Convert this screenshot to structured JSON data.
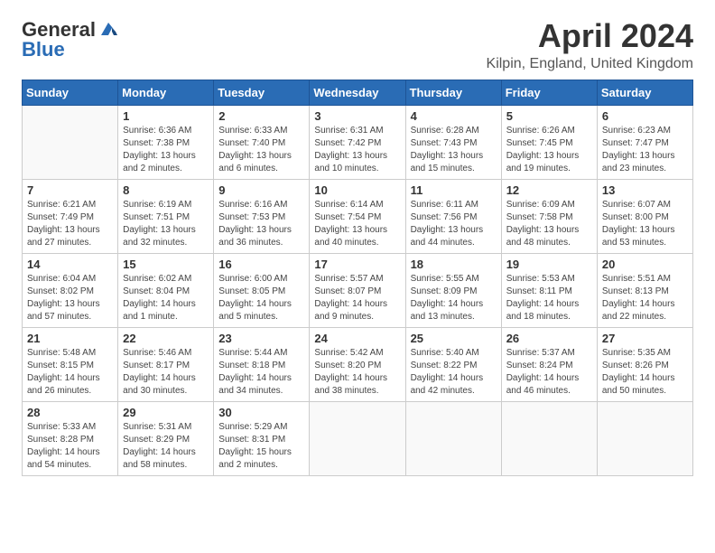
{
  "header": {
    "logo_general": "General",
    "logo_blue": "Blue",
    "title": "April 2024",
    "subtitle": "Kilpin, England, United Kingdom"
  },
  "days_of_week": [
    "Sunday",
    "Monday",
    "Tuesday",
    "Wednesday",
    "Thursday",
    "Friday",
    "Saturday"
  ],
  "weeks": [
    [
      {
        "day": "",
        "info": ""
      },
      {
        "day": "1",
        "info": "Sunrise: 6:36 AM\nSunset: 7:38 PM\nDaylight: 13 hours\nand 2 minutes."
      },
      {
        "day": "2",
        "info": "Sunrise: 6:33 AM\nSunset: 7:40 PM\nDaylight: 13 hours\nand 6 minutes."
      },
      {
        "day": "3",
        "info": "Sunrise: 6:31 AM\nSunset: 7:42 PM\nDaylight: 13 hours\nand 10 minutes."
      },
      {
        "day": "4",
        "info": "Sunrise: 6:28 AM\nSunset: 7:43 PM\nDaylight: 13 hours\nand 15 minutes."
      },
      {
        "day": "5",
        "info": "Sunrise: 6:26 AM\nSunset: 7:45 PM\nDaylight: 13 hours\nand 19 minutes."
      },
      {
        "day": "6",
        "info": "Sunrise: 6:23 AM\nSunset: 7:47 PM\nDaylight: 13 hours\nand 23 minutes."
      }
    ],
    [
      {
        "day": "7",
        "info": "Sunrise: 6:21 AM\nSunset: 7:49 PM\nDaylight: 13 hours\nand 27 minutes."
      },
      {
        "day": "8",
        "info": "Sunrise: 6:19 AM\nSunset: 7:51 PM\nDaylight: 13 hours\nand 32 minutes."
      },
      {
        "day": "9",
        "info": "Sunrise: 6:16 AM\nSunset: 7:53 PM\nDaylight: 13 hours\nand 36 minutes."
      },
      {
        "day": "10",
        "info": "Sunrise: 6:14 AM\nSunset: 7:54 PM\nDaylight: 13 hours\nand 40 minutes."
      },
      {
        "day": "11",
        "info": "Sunrise: 6:11 AM\nSunset: 7:56 PM\nDaylight: 13 hours\nand 44 minutes."
      },
      {
        "day": "12",
        "info": "Sunrise: 6:09 AM\nSunset: 7:58 PM\nDaylight: 13 hours\nand 48 minutes."
      },
      {
        "day": "13",
        "info": "Sunrise: 6:07 AM\nSunset: 8:00 PM\nDaylight: 13 hours\nand 53 minutes."
      }
    ],
    [
      {
        "day": "14",
        "info": "Sunrise: 6:04 AM\nSunset: 8:02 PM\nDaylight: 13 hours\nand 57 minutes."
      },
      {
        "day": "15",
        "info": "Sunrise: 6:02 AM\nSunset: 8:04 PM\nDaylight: 14 hours\nand 1 minute."
      },
      {
        "day": "16",
        "info": "Sunrise: 6:00 AM\nSunset: 8:05 PM\nDaylight: 14 hours\nand 5 minutes."
      },
      {
        "day": "17",
        "info": "Sunrise: 5:57 AM\nSunset: 8:07 PM\nDaylight: 14 hours\nand 9 minutes."
      },
      {
        "day": "18",
        "info": "Sunrise: 5:55 AM\nSunset: 8:09 PM\nDaylight: 14 hours\nand 13 minutes."
      },
      {
        "day": "19",
        "info": "Sunrise: 5:53 AM\nSunset: 8:11 PM\nDaylight: 14 hours\nand 18 minutes."
      },
      {
        "day": "20",
        "info": "Sunrise: 5:51 AM\nSunset: 8:13 PM\nDaylight: 14 hours\nand 22 minutes."
      }
    ],
    [
      {
        "day": "21",
        "info": "Sunrise: 5:48 AM\nSunset: 8:15 PM\nDaylight: 14 hours\nand 26 minutes."
      },
      {
        "day": "22",
        "info": "Sunrise: 5:46 AM\nSunset: 8:17 PM\nDaylight: 14 hours\nand 30 minutes."
      },
      {
        "day": "23",
        "info": "Sunrise: 5:44 AM\nSunset: 8:18 PM\nDaylight: 14 hours\nand 34 minutes."
      },
      {
        "day": "24",
        "info": "Sunrise: 5:42 AM\nSunset: 8:20 PM\nDaylight: 14 hours\nand 38 minutes."
      },
      {
        "day": "25",
        "info": "Sunrise: 5:40 AM\nSunset: 8:22 PM\nDaylight: 14 hours\nand 42 minutes."
      },
      {
        "day": "26",
        "info": "Sunrise: 5:37 AM\nSunset: 8:24 PM\nDaylight: 14 hours\nand 46 minutes."
      },
      {
        "day": "27",
        "info": "Sunrise: 5:35 AM\nSunset: 8:26 PM\nDaylight: 14 hours\nand 50 minutes."
      }
    ],
    [
      {
        "day": "28",
        "info": "Sunrise: 5:33 AM\nSunset: 8:28 PM\nDaylight: 14 hours\nand 54 minutes."
      },
      {
        "day": "29",
        "info": "Sunrise: 5:31 AM\nSunset: 8:29 PM\nDaylight: 14 hours\nand 58 minutes."
      },
      {
        "day": "30",
        "info": "Sunrise: 5:29 AM\nSunset: 8:31 PM\nDaylight: 15 hours\nand 2 minutes."
      },
      {
        "day": "",
        "info": ""
      },
      {
        "day": "",
        "info": ""
      },
      {
        "day": "",
        "info": ""
      },
      {
        "day": "",
        "info": ""
      }
    ]
  ]
}
